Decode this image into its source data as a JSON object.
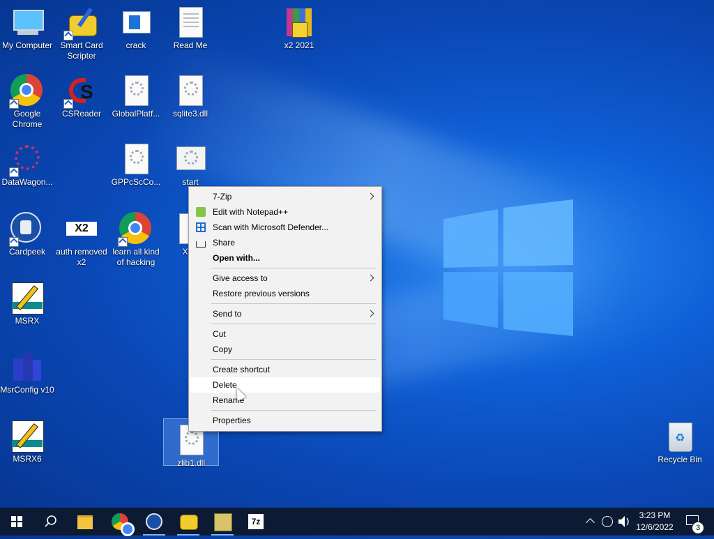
{
  "desktop_icons": [
    {
      "label": "My Computer"
    },
    {
      "label": "Smart Card Scripter"
    },
    {
      "label": "crack"
    },
    {
      "label": "Read Me"
    },
    {
      "label": "x2 2021"
    },
    {
      "label": "Google Chrome"
    },
    {
      "label": "CSReader"
    },
    {
      "label": "GlobalPlatf..."
    },
    {
      "label": "sqlite3.dll"
    },
    {
      "label": "DataWagon..."
    },
    {
      "label": "GPPcScCo..."
    },
    {
      "label": "start"
    },
    {
      "label": "Cardpeek"
    },
    {
      "label": "auth removed x2"
    },
    {
      "label": "learn all kind of hacking"
    },
    {
      "label": "X2A"
    },
    {
      "label": "MSRX"
    },
    {
      "label": "MsrConfig v10"
    },
    {
      "label": "MSRX6"
    },
    {
      "label": "zlib1.dll"
    },
    {
      "label": "Recycle Bin"
    }
  ],
  "context_menu": {
    "items": [
      {
        "label": "7-Zip"
      },
      {
        "label": "Edit with Notepad++"
      },
      {
        "label": "Scan with Microsoft Defender..."
      },
      {
        "label": "Share"
      },
      {
        "label": "Open with..."
      },
      {
        "label": "Give access to"
      },
      {
        "label": "Restore previous versions"
      },
      {
        "label": "Send to"
      },
      {
        "label": "Cut"
      },
      {
        "label": "Copy"
      },
      {
        "label": "Create shortcut"
      },
      {
        "label": "Delete"
      },
      {
        "label": "Rename"
      },
      {
        "label": "Properties"
      }
    ]
  },
  "taskbar": {
    "time": "3:23 PM",
    "date": "12/6/2022",
    "notification_count": "3"
  },
  "colors": {
    "accent": "#0a5bd3",
    "taskbar": "#0c1b33"
  }
}
